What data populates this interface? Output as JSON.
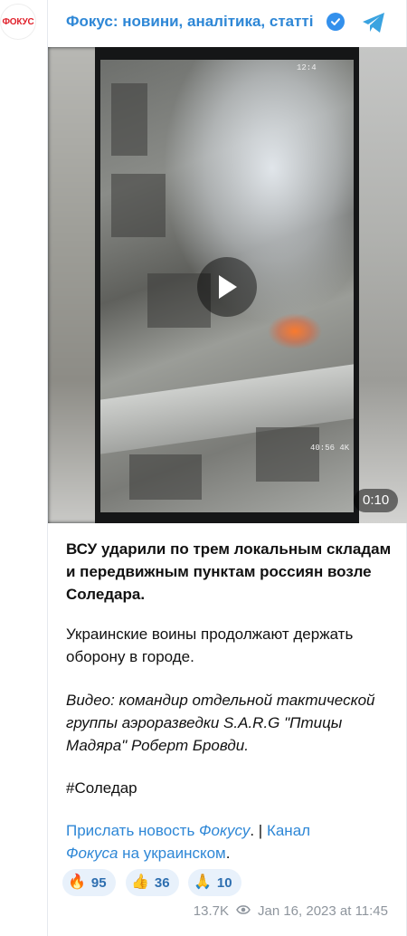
{
  "channel": {
    "name": "Фокус: новини, аналітика, статті",
    "avatar_text": "ФОКУС"
  },
  "video": {
    "duration": "0:10",
    "hud_top": "12:4",
    "hud_bottom": "40:56 4K"
  },
  "post": {
    "headline": "ВСУ ударили по трем локальным складам и передвижным пунктам россиян возле Соледара.",
    "paragraph": "Украинские воины продолжают держать оборону в городе.",
    "credit": "Видео: командир отдельной тактической группы аэроразведки S.A.R.G \"Птицы Мадяра\" Роберт Бровди.",
    "hashtag": "#Соледар",
    "links": {
      "part1": "Прислать новость ",
      "part2": "Фокусу",
      "separator": ". | ",
      "part3": "Канал",
      "part4": "Фокуса",
      "part5": " на украинском",
      "end": "."
    }
  },
  "reactions": [
    {
      "emoji": "🔥",
      "count": "95"
    },
    {
      "emoji": "👍",
      "count": "36"
    },
    {
      "emoji": "🙏",
      "count": "10"
    }
  ],
  "meta": {
    "views": "13.7K",
    "timestamp": "Jan 16, 2023 at 11:45"
  },
  "colors": {
    "accent": "#2e87d6",
    "reaction_bg": "#e8f1fb",
    "brand_red": "#e0202a"
  }
}
